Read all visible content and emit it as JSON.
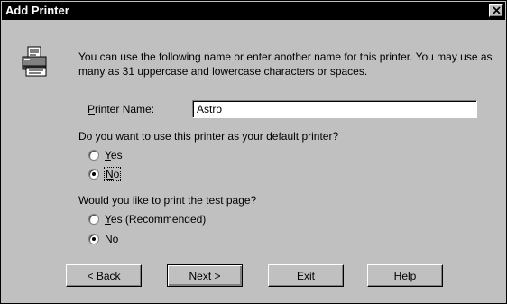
{
  "window": {
    "title": "Add Printer"
  },
  "intro": {
    "text": "You can use the following name or enter another name for this printer. You may use as many as 31 uppercase and lowercase characters or spaces."
  },
  "printer_name": {
    "label_mnemonic": "P",
    "label_rest": "rinter Name:",
    "value": "Astro"
  },
  "default_question": {
    "text": "Do you want to use this printer as your default printer?",
    "options": [
      {
        "mnemonic": "Y",
        "rest": "es",
        "selected": false
      },
      {
        "mnemonic": "N",
        "rest": "o",
        "selected": true
      }
    ]
  },
  "test_question": {
    "text": "Would you like to print the test page?",
    "options": [
      {
        "mnemonic": "Y",
        "rest": "es (Recommended)",
        "selected": false
      },
      {
        "pre": "N",
        "mnemonic": "o",
        "rest": "",
        "selected": true
      }
    ]
  },
  "buttons": {
    "back": {
      "prefix": "< ",
      "mnemonic": "B",
      "rest": "ack"
    },
    "next": {
      "mnemonic": "N",
      "rest": "ext >"
    },
    "exit": {
      "mnemonic": "E",
      "rest": "xit"
    },
    "help": {
      "mnemonic": "H",
      "rest": "elp"
    }
  }
}
